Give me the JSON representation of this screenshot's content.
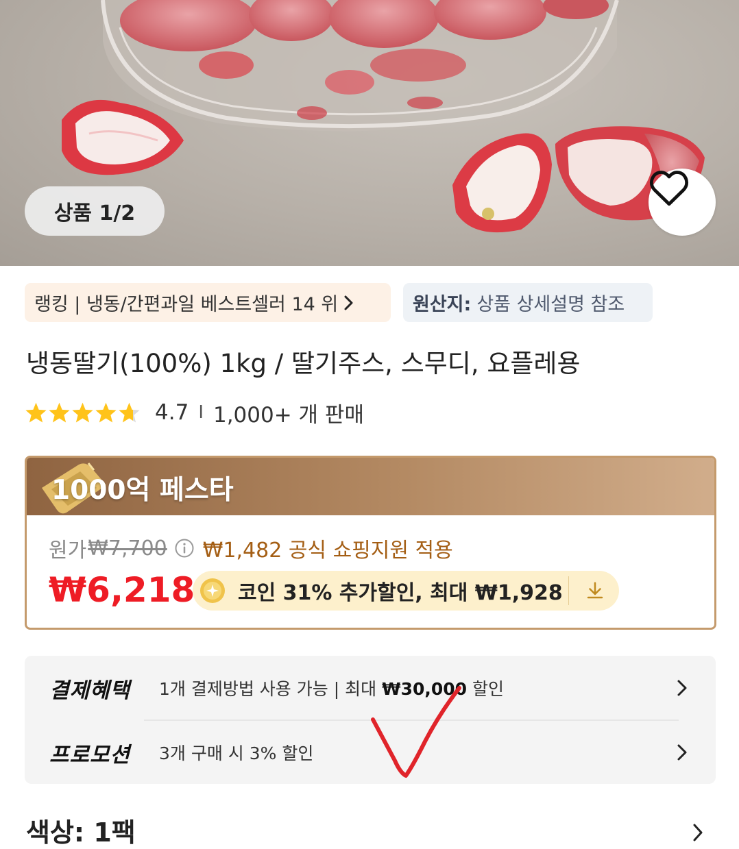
{
  "gallery": {
    "counter": "상품 1/2"
  },
  "badges": {
    "ranking": "랭킹 | 냉동/간편과일 베스트셀러 14 위",
    "origin_label": "원산지:",
    "origin_value": "상품 상세설명 참조"
  },
  "product": {
    "title": "냉동딸기(100%) 1kg / 딸기주스, 스무디, 요플레용",
    "rating": "4.7",
    "rating_stars": 4.7,
    "separator": "I",
    "sold": "1,000+ 개 판매"
  },
  "promo_banner": {
    "title": "1000억 페스타"
  },
  "price": {
    "original_label": "원가",
    "original_value": "₩7,700",
    "support_text": "₩1,482 공식 쇼핑지원 적용",
    "sale_price": "₩6,218",
    "coin_text": "코인 31% 추가할인, 최대 ₩1,928"
  },
  "benefits": {
    "payment_label": "결제혜택",
    "payment_desc_prefix": "1개 결제방법 사용 가능 | 최대 ",
    "payment_desc_amount": "₩30,000",
    "payment_desc_suffix": " 할인",
    "promotion_label": "프로모션",
    "promotion_desc": "3개 구매 시 3% 할인"
  },
  "option": {
    "color": "색상: 1팩"
  },
  "colors": {
    "sale_red": "#ee1c25",
    "support_brown": "#a45e14",
    "banner_start": "#8f6441",
    "banner_end": "#d1ad8b",
    "coin_pill": "#fdf0cc",
    "annotation_red": "#e0242a"
  },
  "icons": {
    "wishlist": "heart-outline-icon",
    "ranking": "chevron-right-icon",
    "info": "info-circle-icon",
    "coin": "coin-icon",
    "download": "download-icon",
    "benefit": "chevron-right-icon"
  }
}
